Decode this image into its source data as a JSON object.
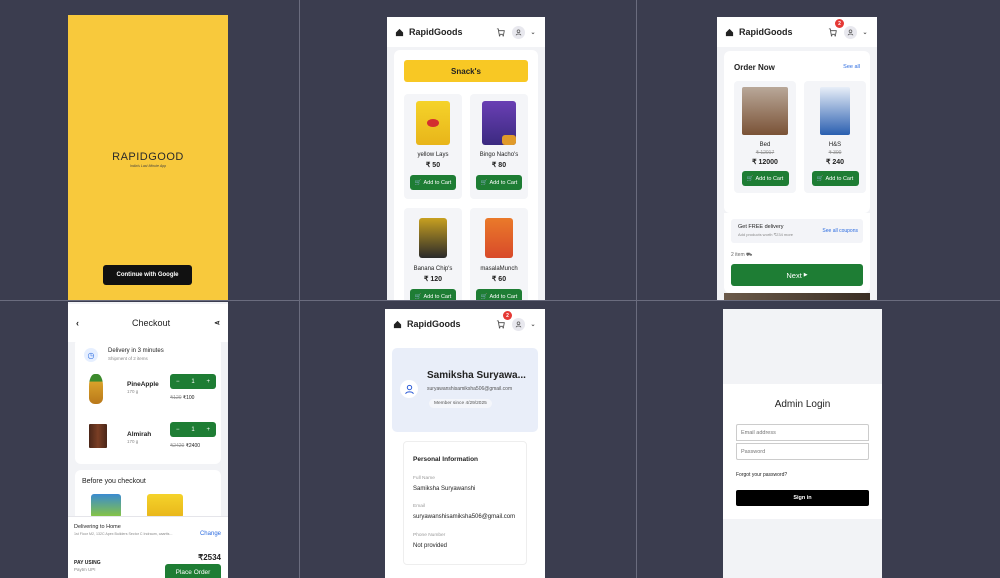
{
  "splash": {
    "brand": "RAPIDGOOD",
    "tagline": "India's Last Minute App",
    "google_button": "Continue with Google"
  },
  "header": {
    "brand": "RapidGoods",
    "cart_count": "2"
  },
  "snacks": {
    "category": "Snack's",
    "products": [
      {
        "name": "yellow Lays",
        "price": "₹ 50",
        "cta": "Add to Cart"
      },
      {
        "name": "Bingo Nacho's",
        "price": "₹ 80",
        "cta": "Add to Cart"
      },
      {
        "name": "Banana Chip's",
        "price": "₹ 120",
        "cta": "Add to Cart"
      },
      {
        "name": "masalaMunch",
        "price": "₹ 60",
        "cta": "Add to Cart"
      }
    ]
  },
  "order_now": {
    "title": "Order Now",
    "see_all": "See all",
    "products": [
      {
        "name": "Bed",
        "mrp": "₹ 12017",
        "price": "₹ 12000",
        "cta": "Add to Cart"
      },
      {
        "name": "H&S",
        "mrp": "₹ 300",
        "price": "₹ 240",
        "cta": "Add to Cart"
      }
    ],
    "coupon_title": "Get FREE delivery",
    "coupon_sub": "Add products worth ₹234 more",
    "coupon_link": "See all coupons",
    "items_count": "2 item",
    "next_button": "Next"
  },
  "checkout": {
    "title": "Checkout",
    "delivery_title": "Delivery in 3 minutes",
    "delivery_sub": "Shipment of 2 items",
    "items": [
      {
        "name": "PineApple",
        "weight": "170 g",
        "mrp": "₹120",
        "price": "₹100",
        "qty": "1"
      },
      {
        "name": "Almirah",
        "weight": "170 g",
        "mrp": "₹2420",
        "price": "₹2400",
        "qty": "1"
      }
    ],
    "before_title": "Before you checkout",
    "deliver_to": "Delivering to Home",
    "address": "1st Floor M2, 132C Apex Builders Sector C Indraum, caartts...",
    "change": "Change",
    "total": "₹2534",
    "pay_using": "PAY USING",
    "pay_method": "Paytm UPI",
    "place_order": "Place Order"
  },
  "profile": {
    "name": "Samiksha Suryawa...",
    "email": "suryawanshisamiksha506@gmail.com",
    "member_since": "Member since 4/29/2025",
    "section_title": "Personal Information",
    "full_name_label": "Full Name",
    "full_name": "Samiksha Suryawanshi",
    "email_label": "Email",
    "email_value": "suryawanshisamiksha506@gmail.com",
    "phone_label": "Phone Number",
    "phone_value": "Not provided"
  },
  "admin": {
    "title": "Admin Login",
    "email_placeholder": "Email address",
    "password_placeholder": "Password",
    "forgot": "Forgot your password?",
    "sign_in": "Sign in"
  },
  "colors": {
    "splash_bg": "#f8c93c",
    "green": "#1e7d34",
    "snack_banner": "#f8c824",
    "badge": "#e53935"
  }
}
